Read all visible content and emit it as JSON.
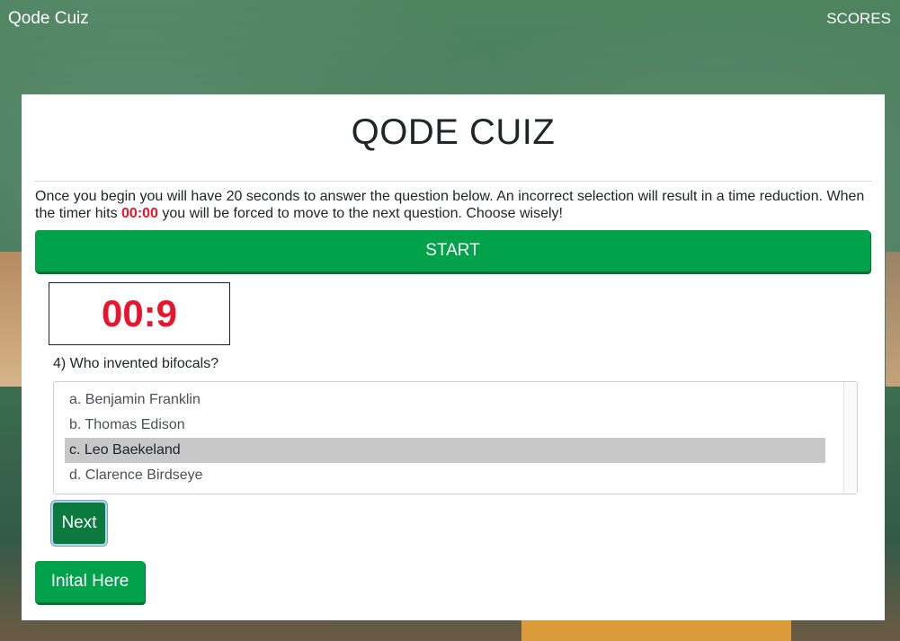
{
  "navbar": {
    "brand": "Qode Cuiz",
    "scores_link": "SCORES"
  },
  "card": {
    "title": "QODE CUIZ",
    "instructions": {
      "part1": "Once you begin you will have 20 seconds to answer the question below. An incorrect selection will result in a time reduction. When the timer hits ",
      "highlight": "00:00",
      "part2": " you will be forced to move to the next question. Choose wisely!"
    },
    "start_label": "START",
    "timer": "00:9",
    "question": "4) Who invented bifocals?",
    "answers": [
      {
        "label": "a. Benjamin Franklin",
        "selected": false
      },
      {
        "label": "b. Thomas Edison",
        "selected": false
      },
      {
        "label": "c. Leo Baekeland",
        "selected": true
      },
      {
        "label": "d. Clarence Birdseye",
        "selected": false
      }
    ],
    "next_label": "Next",
    "initial_label": "Inital Here"
  },
  "colors": {
    "accent_green": "#00a24a",
    "next_green": "#0a7a3f",
    "timer_red": "#e8162d",
    "selected_bg": "#c8c8c8"
  }
}
